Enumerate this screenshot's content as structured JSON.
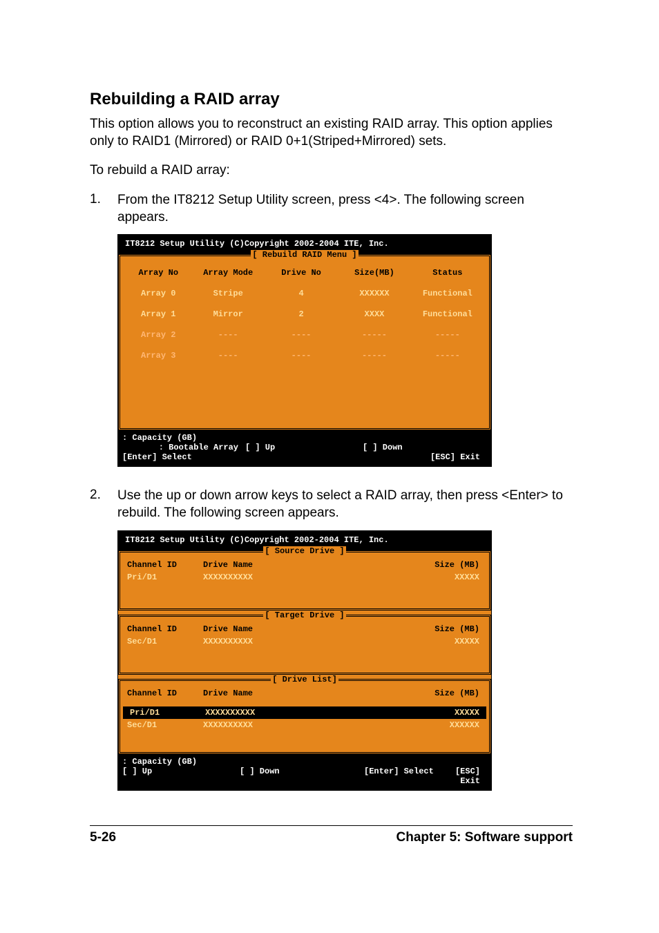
{
  "heading": "Rebuilding a RAID array",
  "intro": "This option allows you to reconstruct an existing RAID array. This option applies only to RAID1 (Mirrored) or RAID 0+1(Striped+Mirrored) sets.",
  "preamble": "To rebuild a RAID array:",
  "step1_num": "1.",
  "step1_text": "From the IT8212 Setup Utility screen, press <4>. The following screen appears.",
  "step2_num": "2.",
  "step2_text": "Use the up or down arrow keys to select a RAID array, then press <Enter> to rebuild. The following screen appears.",
  "bios_title": "IT8212 Setup Utility (C)Copyright 2002-2004 ITE, Inc.",
  "screen1": {
    "menu_title": "[ Rebuild RAID Menu ]",
    "columns": {
      "c1": "Array No",
      "c2": "Array Mode",
      "c3": "Drive No",
      "c4": "Size(MB)",
      "c5": "Status"
    },
    "rows": [
      {
        "c1": "Array 0",
        "c2": "Stripe",
        "c3": "4",
        "c4": "XXXXXX",
        "c5": "Functional",
        "dim": false
      },
      {
        "c1": "Array 1",
        "c2": "Mirror",
        "c3": "2",
        "c4": "XXXX",
        "c5": "Functional",
        "dim": false
      },
      {
        "c1": "Array 2",
        "c2": "----",
        "c3": "----",
        "c4": "-----",
        "c5": "-----",
        "dim": true
      },
      {
        "c1": "Array 3",
        "c2": "----",
        "c3": "----",
        "c4": "-----",
        "c5": "-----",
        "dim": true
      }
    ],
    "footer": {
      "capacity": ": Capacity (GB)",
      "bootable": ": Bootable Array",
      "up": "[ ] Up",
      "down": "[ ] Down",
      "select": "[Enter] Select",
      "exit": "[ESC] Exit"
    }
  },
  "screen2": {
    "source_title": "[ Source Drive ]",
    "target_title": "[ Target Drive ]",
    "list_title": "[ Drive List]",
    "sd_header": {
      "c1": "Channel ID",
      "c2": "Drive Name",
      "c3": "Size (MB)"
    },
    "source_row": {
      "c1": "Pri/D1",
      "c2": "XXXXXXXXXX",
      "c3": "XXXXX"
    },
    "target_row": {
      "c1": "Sec/D1",
      "c2": "XXXXXXXXXX",
      "c3": "XXXXX"
    },
    "list_rows": [
      {
        "c1": "Pri/D1",
        "c2": "XXXXXXXXXX",
        "c3": "XXXXX",
        "hl": true
      },
      {
        "c1": "Sec/D1",
        "c2": "XXXXXXXXXX",
        "c3": "XXXXXX",
        "hl": false
      }
    ],
    "footer": {
      "capacity": ": Capacity (GB)",
      "up": "[ ] Up",
      "down": "[ ] Down",
      "select": "[Enter] Select",
      "exit": "[ESC] Exit"
    }
  },
  "page_footer_left": "5-26",
  "page_footer_right": "Chapter 5: Software support"
}
